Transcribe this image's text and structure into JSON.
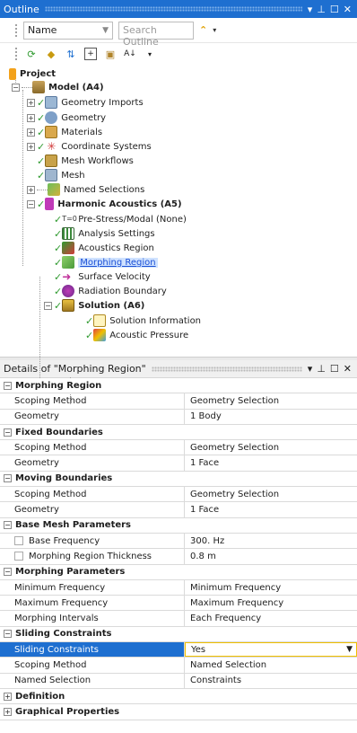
{
  "outline": {
    "title": "Outline",
    "controls": {
      "pin": "▾",
      "pushpin": "⊥",
      "restore": "☐",
      "close": "✕"
    },
    "filter_select": "Name",
    "search_placeholder": "Search Outline",
    "tree": [
      {
        "label": "Project",
        "bold": true,
        "icon": "project-icon"
      },
      {
        "label": "Model (A4)",
        "bold": true,
        "icon": "model-icon"
      },
      {
        "label": "Geometry Imports",
        "icon": "geometry-imports-icon"
      },
      {
        "label": "Geometry",
        "icon": "geometry-icon"
      },
      {
        "label": "Materials",
        "icon": "materials-icon"
      },
      {
        "label": "Coordinate Systems",
        "icon": "coordinate-systems-icon"
      },
      {
        "label": "Mesh Workflows",
        "icon": "mesh-workflows-icon"
      },
      {
        "label": "Mesh",
        "icon": "mesh-icon"
      },
      {
        "label": "Named Selections",
        "icon": "named-selections-icon"
      },
      {
        "label": "Harmonic Acoustics (A5)",
        "bold": true,
        "icon": "harmonic-acoustics-icon"
      },
      {
        "label": "Pre-Stress/Modal (None)",
        "icon": "prestress-icon"
      },
      {
        "label": "Analysis Settings",
        "icon": "analysis-settings-icon"
      },
      {
        "label": "Acoustics Region",
        "icon": "acoustics-region-icon"
      },
      {
        "label": "Morphing Region",
        "icon": "morphing-region-icon",
        "selected": true
      },
      {
        "label": "Surface Velocity",
        "icon": "surface-velocity-icon"
      },
      {
        "label": "Radiation Boundary",
        "icon": "radiation-boundary-icon"
      },
      {
        "label": "Solution (A6)",
        "bold": true,
        "icon": "solution-icon"
      },
      {
        "label": "Solution Information",
        "icon": "solution-information-icon"
      },
      {
        "label": "Acoustic Pressure",
        "icon": "acoustic-pressure-icon"
      }
    ]
  },
  "details": {
    "title": "Details of \"Morphing Region\"",
    "sections": [
      {
        "name": "Morphing Region",
        "expanded": true,
        "rows": [
          {
            "key": "Scoping Method",
            "value": "Geometry Selection"
          },
          {
            "key": "Geometry",
            "value": "1 Body"
          }
        ]
      },
      {
        "name": "Fixed Boundaries",
        "expanded": true,
        "rows": [
          {
            "key": "Scoping Method",
            "value": "Geometry Selection"
          },
          {
            "key": "Geometry",
            "value": "1 Face"
          }
        ]
      },
      {
        "name": "Moving Boundaries",
        "expanded": true,
        "rows": [
          {
            "key": "Scoping Method",
            "value": "Geometry Selection"
          },
          {
            "key": "Geometry",
            "value": "1 Face"
          }
        ]
      },
      {
        "name": "Base Mesh Parameters",
        "expanded": true,
        "rows": [
          {
            "key": "Base Frequency",
            "value": "300. Hz",
            "checkbox": true
          },
          {
            "key": "Morphing Region Thickness",
            "value": "0.8 m",
            "checkbox": true
          }
        ]
      },
      {
        "name": "Morphing Parameters",
        "expanded": true,
        "rows": [
          {
            "key": "Minimum Frequency",
            "value": "Minimum Frequency"
          },
          {
            "key": "Maximum Frequency",
            "value": "Maximum Frequency"
          },
          {
            "key": "Morphing Intervals",
            "value": "Each Frequency"
          }
        ]
      },
      {
        "name": "Sliding Constraints",
        "expanded": true,
        "rows": [
          {
            "key": "Sliding Constraints",
            "value": "Yes",
            "highlighted": true,
            "dropdown": true
          },
          {
            "key": "Scoping Method",
            "value": "Named Selection"
          },
          {
            "key": "Named Selection",
            "value": "Constraints"
          }
        ]
      },
      {
        "name": "Definition",
        "expanded": false,
        "rows": []
      },
      {
        "name": "Graphical Properties",
        "expanded": false,
        "rows": []
      }
    ]
  },
  "colors": {
    "title_bar": "#1e6fd0",
    "selection": "#1e6fd0",
    "check_green": "#2f9a2f"
  }
}
